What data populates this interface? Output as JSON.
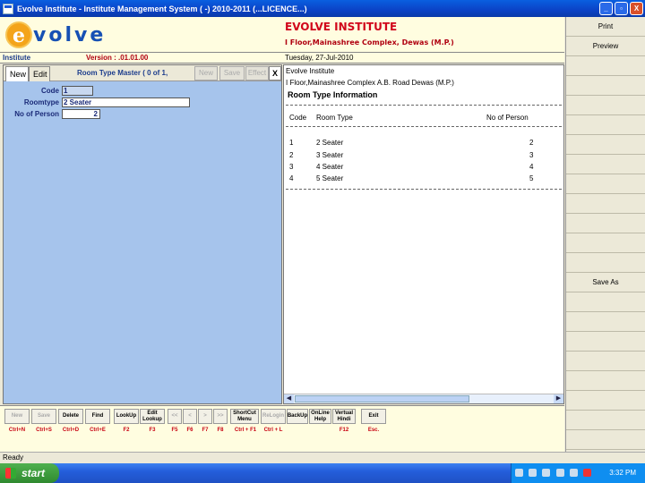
{
  "window": {
    "title": "Evolve Institute - Institute Management System ( -) 2010-2011 (...LICENCE...)",
    "min": "_",
    "max": "▫",
    "close": "X"
  },
  "header": {
    "logo_e": "e",
    "logo_rest": "volve",
    "inst_name": "EVOLVE INSTITUTE",
    "inst_addr": "I Floor,Mainashree Complex, Dewas (M.P.)"
  },
  "infobar": {
    "institute": "Institute",
    "version": "Version : .01.01.00",
    "date": "Tuesday, 27-Jul-2010"
  },
  "form": {
    "tab_new": "New",
    "tab_edit": "Edit",
    "title": "Room Type Master  ( 0 of 1,",
    "btn_new": "New",
    "btn_save": "Save",
    "btn_effect": "Effect",
    "btn_close": "X",
    "code_label": "Code",
    "code_value": "1",
    "roomtype_label": "Roomtype",
    "roomtype_value": "2 Seater",
    "persons_label": "No of Person",
    "persons_value": "2"
  },
  "report": {
    "org": "Evolve Institute",
    "address": "I Floor,Mainashree Complex A.B. Road Dewas (M.P.)",
    "heading": "Room Type Information",
    "col_code": "Code",
    "col_roomtype": "Room Type",
    "col_persons": "No of Person",
    "rows": [
      {
        "code": "1",
        "roomtype": "2 Seater",
        "persons": "2"
      },
      {
        "code": "2",
        "roomtype": "3 Seater",
        "persons": "3"
      },
      {
        "code": "3",
        "roomtype": "4 Seater",
        "persons": "4"
      },
      {
        "code": "4",
        "roomtype": "5 Seater",
        "persons": "5"
      }
    ]
  },
  "right_panel": {
    "print": "Print",
    "preview": "Preview",
    "save_as": "Save As"
  },
  "toolbar": [
    {
      "label": "New",
      "shortcut": "Ctrl+N",
      "enabled": false
    },
    {
      "label": "Save",
      "shortcut": "Ctrl+S",
      "enabled": false
    },
    {
      "label": "Delete",
      "shortcut": "Ctrl+D",
      "enabled": true
    },
    {
      "label": "Find",
      "shortcut": "Ctrl+E",
      "enabled": true
    },
    {
      "label": "LookUp",
      "shortcut": "F2",
      "enabled": true
    },
    {
      "label": "Edit Lookup",
      "shortcut": "F3",
      "enabled": true
    },
    {
      "label": "<<",
      "shortcut": "F5",
      "enabled": false
    },
    {
      "label": "<",
      "shortcut": "F6",
      "enabled": false
    },
    {
      "label": ">",
      "shortcut": "F7",
      "enabled": false
    },
    {
      "label": ">>",
      "shortcut": "F8",
      "enabled": false
    },
    {
      "label": "ShortCut Menu",
      "shortcut": "Ctrl + F1",
      "enabled": true
    },
    {
      "label": "ReLogin",
      "shortcut": "Ctrl + L",
      "enabled": false
    },
    {
      "label": "BackUp",
      "shortcut": "",
      "enabled": true
    },
    {
      "label": "OnLine Help",
      "shortcut": "",
      "enabled": true
    },
    {
      "label": "Vertual Hindi",
      "shortcut": "F12",
      "enabled": true
    },
    {
      "label": "Exit",
      "shortcut": "Esc.",
      "enabled": true
    }
  ],
  "status": {
    "text": "Ready"
  },
  "taskbar": {
    "start": "start",
    "clock": "3:32 PM"
  },
  "colors": {
    "form_bg": "#a6c4ec",
    "header_bg": "#fffde0",
    "title_red": "#d1051a",
    "accent_blue": "#1650b4"
  }
}
